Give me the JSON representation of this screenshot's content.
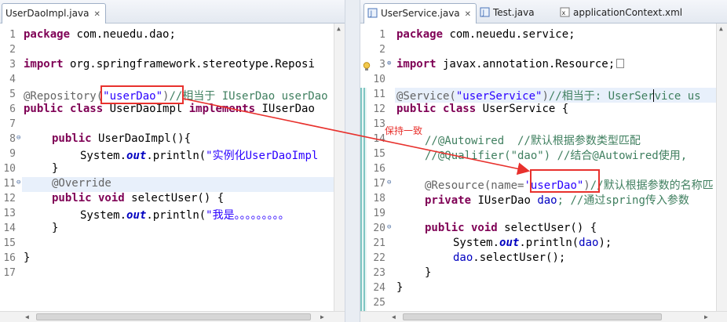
{
  "left_editor": {
    "tab_label": "UserDaoImpl.java",
    "lines": {
      "n1": "1",
      "n2": "2",
      "n3": "3",
      "n4": "4",
      "n5": "5",
      "n6": "6",
      "n7": "7",
      "n8": "8",
      "n9": "9",
      "n10": "10",
      "n11": "11",
      "n12": "12",
      "n13": "13",
      "n14": "14",
      "n15": "15",
      "n16": "16",
      "n17": "17"
    },
    "code": {
      "l1_kw": "package",
      "l1_rest": " com.neuedu.dao;",
      "l3_kw": "import",
      "l3_rest": " org.springframework.stereotype.Reposi",
      "l5_ann": "@Repository(",
      "l5_str": "\"userDao\"",
      "l5_paren": ")",
      "l5_cmt": "//相当于 IUserDao userDao",
      "l6_kw1": "public class",
      "l6_mid": " UserDaoImpl ",
      "l6_kw2": "implements",
      "l6_rest": " IUserDao",
      "l8_kw": "public",
      "l8_rest": " UserDaoImpl(){",
      "l9_pre": "System.",
      "l9_out": "out",
      "l9_mid": ".println(",
      "l9_str": "\"实例化UserDaoImpl",
      "l10": "}",
      "l11": "@Override",
      "l12_kw": "public void",
      "l12_rest": " selectUser() {",
      "l13_pre": "System.",
      "l13_out": "out",
      "l13_mid": ".println(",
      "l13_str": "\"我是。。。。。。。。。",
      "l14": "}",
      "l16": "}"
    }
  },
  "right_editor": {
    "tabs": {
      "t1": "UserService.java",
      "t2": "Test.java",
      "t3": "applicationContext.xml"
    },
    "lines": {
      "n1": "1",
      "n2": "2",
      "n3": "3",
      "n10": "10",
      "n11": "11",
      "n12": "12",
      "n13": "13",
      "n14": "14",
      "n15": "15",
      "n16": "16",
      "n17": "17",
      "n18": "18",
      "n19": "19",
      "n20": "20",
      "n21": "21",
      "n22": "22",
      "n23": "23",
      "n24": "24",
      "n25": "25"
    },
    "code": {
      "l1_kw": "package",
      "l1_rest": " com.neuedu.service;",
      "l3_kw": "import",
      "l3_rest": " javax.annotation.Resource;",
      "l11_ann": "@Service(",
      "l11_str": "\"userService\"",
      "l11_paren": ")",
      "l11_cmt": "//相当于: UserService us",
      "l12_kw": "public class",
      "l12_rest": " UserService {",
      "l14": "//@Autowired  //默认根据参数类型匹配",
      "l15": "//@Qualifier(\"dao\") //结合@Autowired使用,",
      "l17_ann": "@Resource(name=",
      "l17_str": "'userDao\"",
      "l17_paren": ")",
      "l17_cmt": "//默认根据参数的名称匹",
      "l18_kw": "private",
      "l18_mid": " IUserDao ",
      "l18_field": "dao",
      "l18_cmt": "; //通过spring传入参数",
      "l20_kw": "public void",
      "l20_rest": " selectUser() {",
      "l21_pre": "System.",
      "l21_out": "out",
      "l21_mid": ".println(",
      "l21_field": "dao",
      "l21_end": ");",
      "l22_field": "dao",
      "l22_rest": ".selectUser();",
      "l23": "}",
      "l24": "}"
    }
  },
  "annotation": {
    "callout_text": "保持一致",
    "arrow_color": "#e8312d"
  }
}
